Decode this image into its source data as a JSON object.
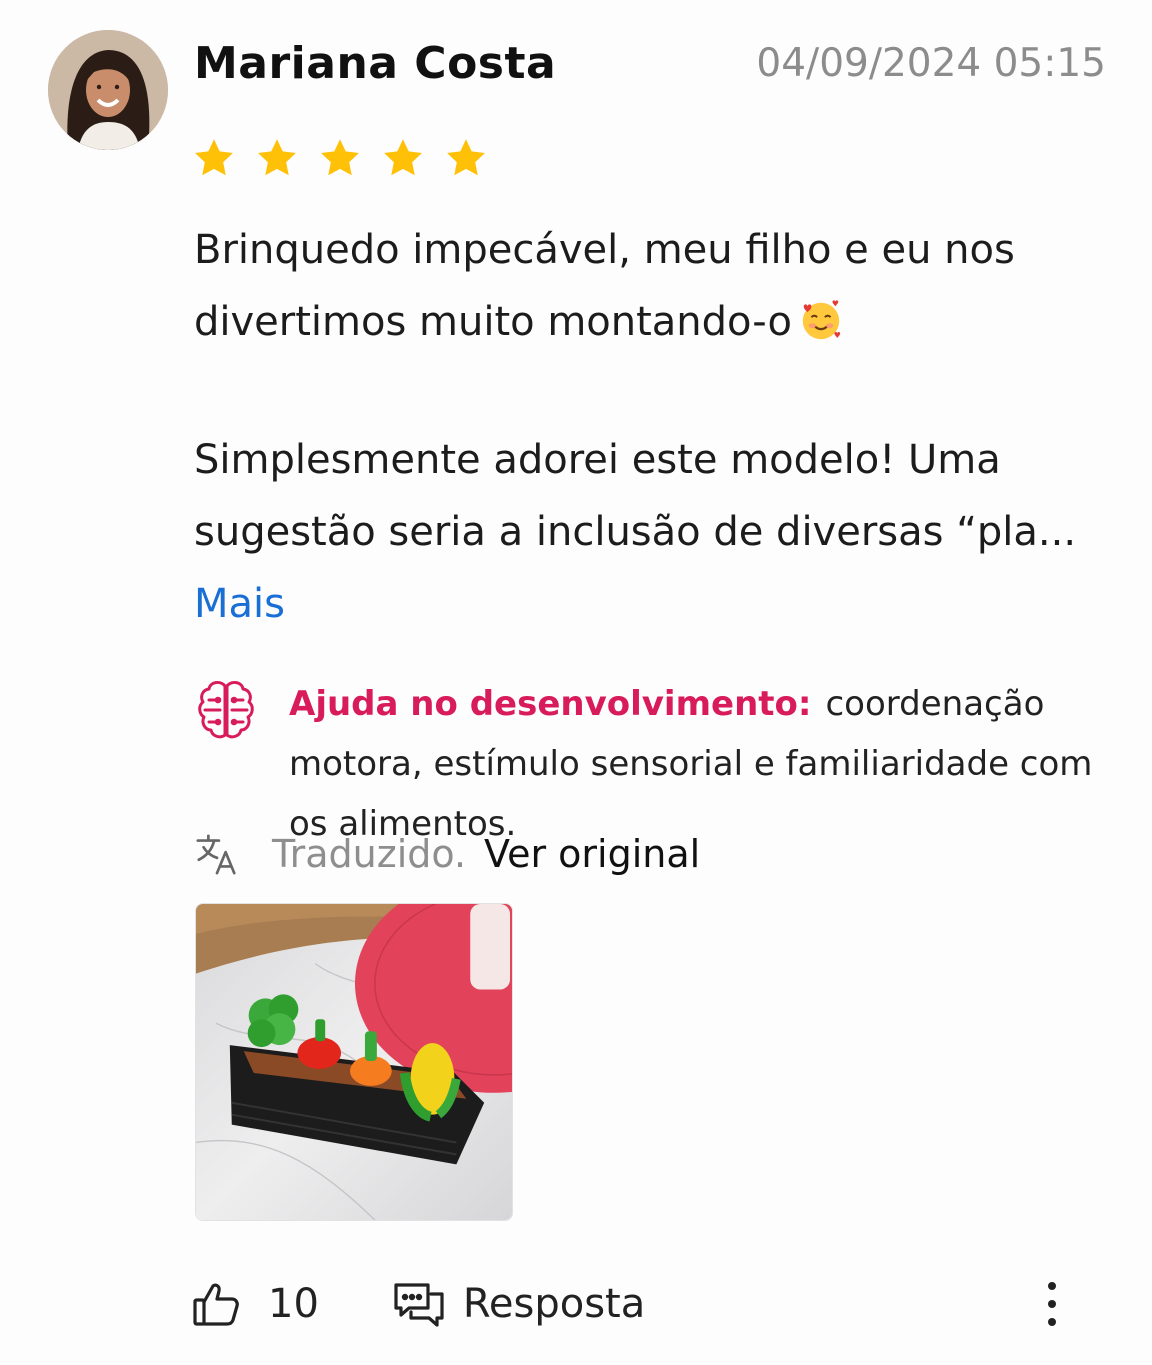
{
  "review": {
    "author": "Mariana Costa",
    "timestamp": "04/09/2024 05:15",
    "rating": 5,
    "rating_max": 5,
    "paragraph_1": "Brinquedo impecável, meu filho e eu nos divertimos muito montando-o",
    "paragraph_1_emoji": "smiling-face-with-hearts",
    "paragraph_2": "Simplesmente adorei este modelo! Uma sugestão seria a inclusão de diversas “pla...",
    "more_label": "Mais"
  },
  "development": {
    "icon": "brain-icon",
    "label": "Ajuda no desenvolvimento:",
    "text": "coordenação motora, estímulo sensorial e familiaridade com os alimentos."
  },
  "translation": {
    "icon": "translate-icon",
    "status": "Traduzido.",
    "link": "Ver original"
  },
  "actions": {
    "like_icon": "thumbs-up-icon",
    "like_count": "10",
    "reply_icon": "chat-bubbles-icon",
    "reply_label": "Resposta",
    "menu_icon": "vertical-dots-icon"
  },
  "colors": {
    "star": "#FFC107",
    "link": "#1A6FD6",
    "accent": "#D81B5A",
    "muted": "#8C8C8C"
  }
}
